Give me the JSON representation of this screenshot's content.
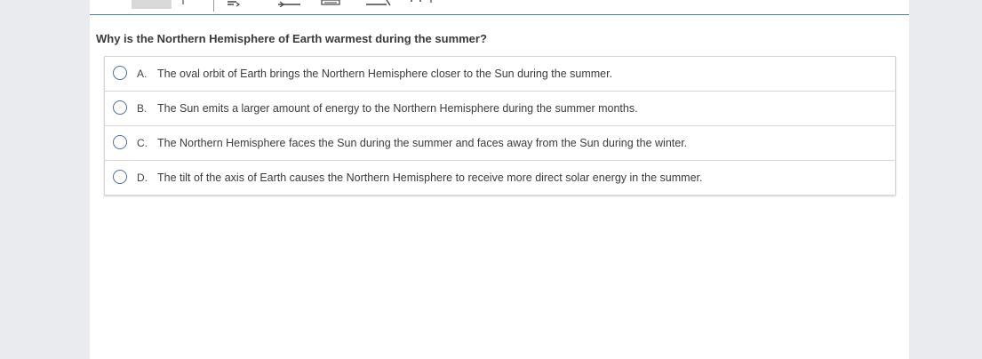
{
  "question": {
    "text": "Why is the Northern Hemisphere of Earth warmest during the summer?"
  },
  "choices": [
    {
      "letter": "A.",
      "text": "The oval orbit of Earth brings the Northern Hemisphere closer to the Sun during the summer."
    },
    {
      "letter": "B.",
      "text": "The Sun emits a larger amount of energy to the Northern Hemisphere during the summer months."
    },
    {
      "letter": "C.",
      "text": "The Northern Hemisphere faces the Sun during the summer and faces away from the Sun during the winter."
    },
    {
      "letter": "D.",
      "text": "The tilt of the axis of Earth causes the Northern Hemisphere to receive more direct solar energy in the summer."
    }
  ],
  "colors": {
    "toolbar_border": "#4a7fb0",
    "radio_border": "#4a6f9c",
    "page_background": "#e9ebee"
  }
}
